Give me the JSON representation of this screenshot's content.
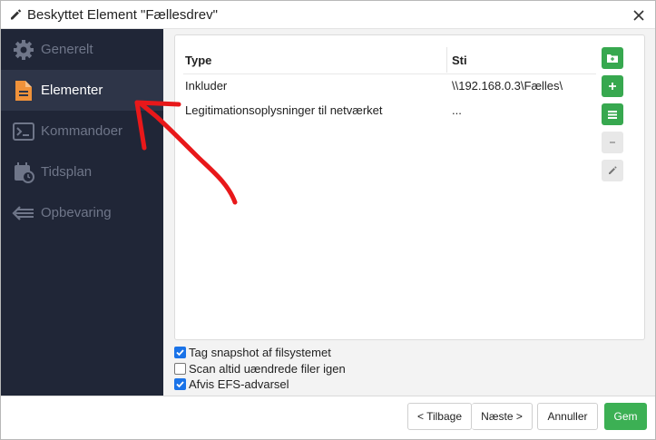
{
  "window": {
    "title": "Beskyttet Element \"Fællesdrev\""
  },
  "sidebar": {
    "items": [
      {
        "label": "Generelt",
        "icon": "gear-icon",
        "active": false
      },
      {
        "label": "Elementer",
        "icon": "document-icon",
        "active": true
      },
      {
        "label": "Kommandoer",
        "icon": "terminal-icon",
        "active": false
      },
      {
        "label": "Tidsplan",
        "icon": "calendar-clock-icon",
        "active": false
      },
      {
        "label": "Opbevaring",
        "icon": "retention-arrow-icon",
        "active": false
      }
    ]
  },
  "table": {
    "columns": [
      "Type",
      "Sti"
    ],
    "rows": [
      {
        "type": "Inkluder",
        "path": "\\\\192.168.0.3\\Fælles\\"
      },
      {
        "type": "Legitimationsoplysninger til netværket",
        "path": "..."
      }
    ]
  },
  "side_buttons": [
    {
      "icon": "add-folder-icon",
      "style": "green"
    },
    {
      "icon": "plus-icon",
      "style": "green"
    },
    {
      "icon": "list-icon",
      "style": "green"
    },
    {
      "icon": "minus-icon",
      "style": "grey"
    },
    {
      "icon": "pencil-icon",
      "style": "grey"
    }
  ],
  "options": [
    {
      "label": "Tag snapshot af filsystemet",
      "checked": true
    },
    {
      "label": "Scan altid uændrede filer igen",
      "checked": false
    },
    {
      "label": "Afvis EFS-advarsel",
      "checked": true
    }
  ],
  "footer": {
    "back": "< Tilbage",
    "next": "Næste >",
    "cancel": "Annuller",
    "save": "Gem"
  },
  "colors": {
    "sidebar_bg": "#202637",
    "sidebar_active": "#2e3548",
    "accent_orange": "#f0923a",
    "green": "#37a84f",
    "annotation_red": "#e8181a"
  }
}
